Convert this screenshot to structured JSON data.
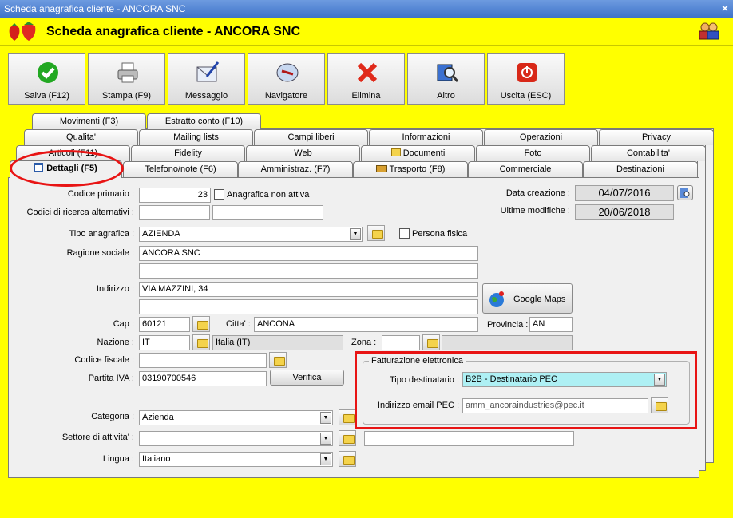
{
  "window": {
    "title": "Scheda anagrafica cliente - ANCORA SNC",
    "close": "×"
  },
  "header": {
    "title": "Scheda anagrafica cliente - ANCORA SNC"
  },
  "toolbar": [
    {
      "label": "Salva (F12)",
      "icon": "check-icon"
    },
    {
      "label": "Stampa (F9)",
      "icon": "printer-icon"
    },
    {
      "label": "Messaggio",
      "icon": "mail-icon"
    },
    {
      "label": "Navigatore",
      "icon": "navigator-icon"
    },
    {
      "label": "Elimina",
      "icon": "delete-icon"
    },
    {
      "label": "Altro",
      "icon": "search-book-icon"
    },
    {
      "label": "Uscita (ESC)",
      "icon": "power-icon"
    }
  ],
  "tabs": {
    "row1": [
      "Movimenti (F3)",
      "Estratto conto (F10)"
    ],
    "row2": [
      "Qualita'",
      "Mailing lists",
      "Campi liberi",
      "Informazioni",
      "Operazioni",
      "Privacy"
    ],
    "row3": [
      "Articoli (F11)",
      "Fidelity",
      "Web",
      "Documenti",
      "Foto",
      "Contabilita'"
    ],
    "row4": [
      "Dettagli (F5)",
      "Telefono/note (F6)",
      "Amministraz. (F7)",
      "Trasporto (F8)",
      "Commerciale",
      "Destinazioni"
    ]
  },
  "form": {
    "codice_primario": {
      "label": "Codice primario :",
      "value": "23"
    },
    "anagrafica_non_attiva": {
      "label": "Anagrafica non attiva",
      "checked": false
    },
    "codici_ricerca": {
      "label": "Codici di ricerca alternativi :",
      "value1": "",
      "value2": ""
    },
    "data_creazione": {
      "label": "Data creazione :",
      "value": "04/07/2016"
    },
    "ultime_modifiche": {
      "label": "Ultime modifiche :",
      "value": "20/06/2018"
    },
    "tipo_anagrafica": {
      "label": "Tipo anagrafica :",
      "value": "AZIENDA"
    },
    "persona_fisica": {
      "label": "Persona fisica",
      "checked": false
    },
    "ragione_sociale": {
      "label": "Ragione sociale :",
      "value1": "ANCORA SNC",
      "value2": ""
    },
    "indirizzo": {
      "label": "Indirizzo :",
      "value1": "VIA MAZZINI, 34",
      "value2": ""
    },
    "google_maps": {
      "label": "Google Maps"
    },
    "cap": {
      "label": "Cap :",
      "value": "60121"
    },
    "citta": {
      "label": "Citta' :",
      "value": "ANCONA"
    },
    "provincia": {
      "label": "Provincia :",
      "value": "AN"
    },
    "nazione": {
      "label": "Nazione :",
      "code": "IT",
      "name": "Italia (IT)"
    },
    "zona": {
      "label": "Zona :",
      "value": "",
      "desc": ""
    },
    "codice_fiscale": {
      "label": "Codice fiscale :",
      "value": ""
    },
    "partita_iva": {
      "label": "Partita IVA :",
      "value": "03190700546"
    },
    "verifica": {
      "label": "Verifica"
    },
    "fatturazione": {
      "title": "Fatturazione elettronica",
      "tipo_destinatario": {
        "label": "Tipo destinatario :",
        "value": "B2B - Destinatario PEC"
      },
      "email_pec": {
        "label": "Indirizzo email PEC :",
        "value": "amm_ancoraindustries@pec.it"
      }
    },
    "categoria": {
      "label": "Categoria :",
      "value": "Azienda"
    },
    "settore": {
      "label": "Settore di attivita' :",
      "value": "",
      "extra": ""
    },
    "lingua": {
      "label": "Lingua :",
      "value": "Italiano"
    }
  },
  "colors": {
    "background": "#ffff00",
    "highlight": "#e81414",
    "tipo_destinatario_bg": "#aef0f4"
  }
}
